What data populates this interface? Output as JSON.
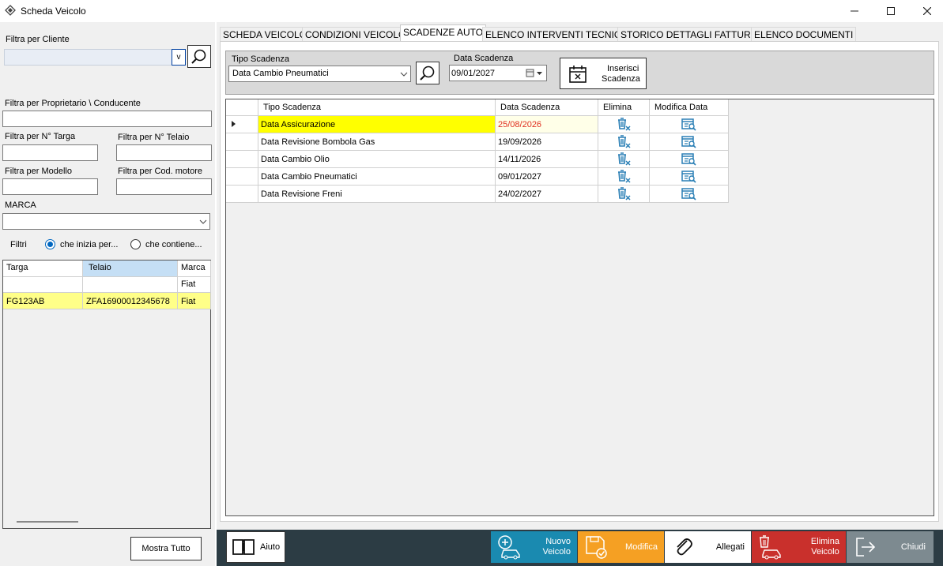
{
  "window": {
    "title": "Scheda Veicolo"
  },
  "left": {
    "filter_cliente_label": "Filtra per Cliente",
    "dropdown_glyph": "v",
    "filter_prop_label": "Filtra per Proprietario \\ Conducente",
    "filter_targa_label": "Filtra per N° Targa",
    "filter_telaio_label": "Filtra per N° Telaio",
    "filter_modello_label": "Filtra per Modello",
    "filter_motore_label": "Filtra per Cod. motore",
    "marca_label": "MARCA",
    "filtri_label": "Filtri",
    "radio_inizia": "che inizia per...",
    "radio_contiene": "che contiene...",
    "grid": {
      "headers": [
        "Targa",
        "Telaio",
        "Marca"
      ],
      "filter_row": [
        "",
        "",
        "Fiat"
      ],
      "rows": [
        [
          "FG123AB",
          "ZFA16900012345678",
          "Fiat"
        ]
      ]
    },
    "mostra_tutto": "Mostra Tutto"
  },
  "tabs": [
    "SCHEDA VEICOLO",
    "CONDIZIONI VEICOLO",
    "SCADENZE AUTO",
    "ELENCO INTERVENTI TECNICI",
    "STORICO DETTAGLI FATTURE",
    "ELENCO DOCUMENTI"
  ],
  "scadenze": {
    "tipo_label": "Tipo Scadenza",
    "tipo_value": "Data Cambio Pneumatici",
    "data_label": "Data Scadenza",
    "data_value": "09/01/2027",
    "inserisci_label_1": "Inserisci",
    "inserisci_label_2": "Scadenza",
    "headers": [
      "Tipo Scadenza",
      "Data Scadenza",
      "Elimina",
      "Modifica Data"
    ],
    "rows": [
      {
        "tipo": "Data Assicurazione",
        "data": "25/08/2026",
        "expired": true
      },
      {
        "tipo": "Data Revisione Bombola Gas",
        "data": "19/09/2026",
        "expired": false
      },
      {
        "tipo": "Data Cambio Olio",
        "data": "14/11/2026",
        "expired": false
      },
      {
        "tipo": "Data Cambio Pneumatici",
        "data": "09/01/2027",
        "expired": false
      },
      {
        "tipo": "Data Revisione Freni",
        "data": "24/02/2027",
        "expired": false
      }
    ]
  },
  "bottom": {
    "aiuto": "Aiuto",
    "nuovo_1": "Nuovo",
    "nuovo_2": "Veicolo",
    "modifica": "Modifica",
    "allegati": "Allegati",
    "elimina_1": "Elimina",
    "elimina_2": "Veicolo",
    "chiudi": "Chiudi"
  },
  "colors": {
    "selected_row": "#ffff00",
    "expired_text": "#e03020",
    "nuovo": "#1a8ab0",
    "modifica": "#f5a023",
    "allegati": "#ffffff",
    "elimina": "#c9302c",
    "chiudi": "#7d8a90",
    "icon_blue": "#2a7fb5"
  }
}
